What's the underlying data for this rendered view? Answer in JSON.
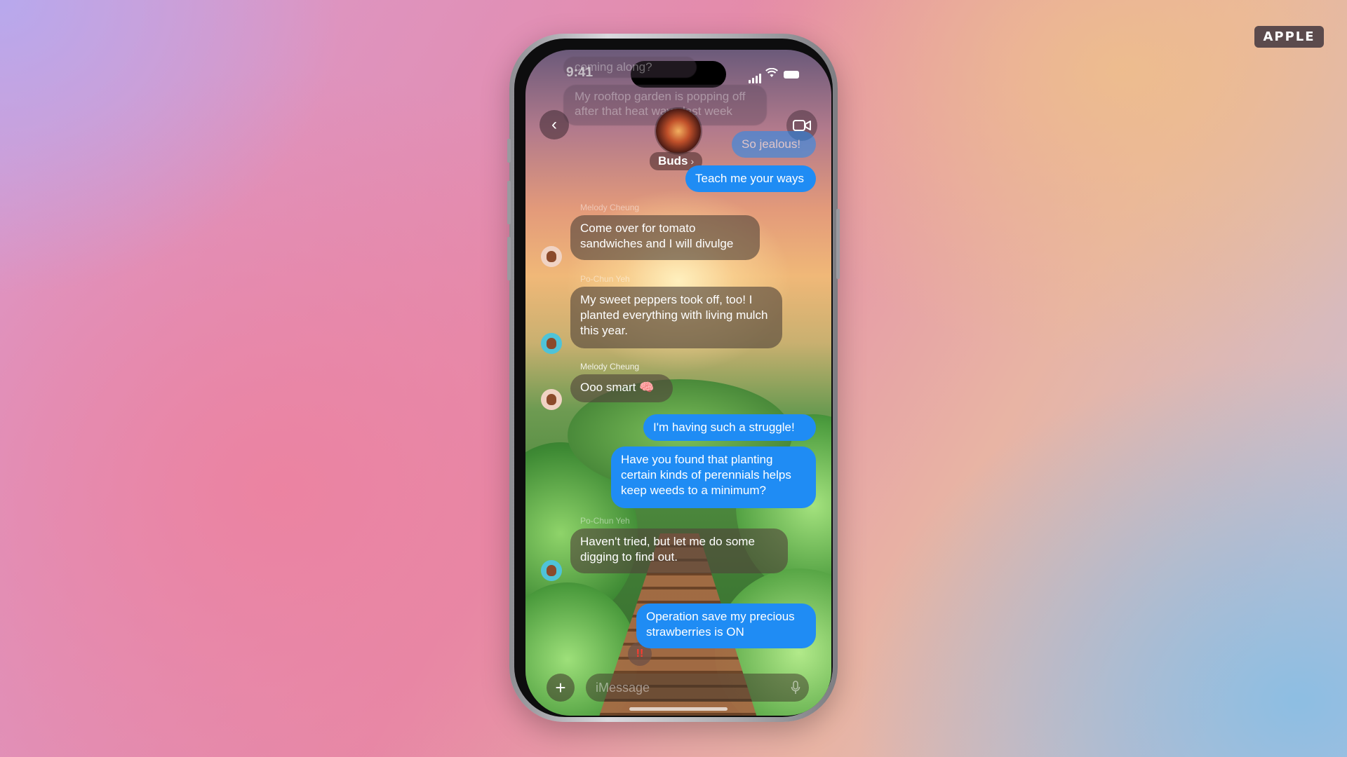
{
  "watermark": "APPLE",
  "status_bar": {
    "time": "9:41"
  },
  "conversation": {
    "group_name": "Buds",
    "group_chevron": "›",
    "back_glyph": "‹",
    "video_icon": "video-camera-icon"
  },
  "ghost_messages": {
    "line1": "coming along?",
    "line2": "My rooftop garden is popping off",
    "line3": "after that heat wave last week"
  },
  "messages": [
    {
      "id": "m1",
      "direction": "outgoing",
      "text": "So jealous!"
    },
    {
      "id": "m2",
      "direction": "outgoing",
      "text": "Teach me your ways"
    },
    {
      "id": "m3",
      "direction": "incoming",
      "sender": "Melody Cheung",
      "text": "Come over for tomato sandwiches and I will divulge"
    },
    {
      "id": "m4",
      "direction": "incoming",
      "sender": "Po-Chun Yeh",
      "text": "My sweet peppers took off, too! I planted everything with living mulch this year."
    },
    {
      "id": "m5",
      "direction": "incoming",
      "sender": "Melody Cheung",
      "text": "Ooo smart",
      "emoji": "🧠"
    },
    {
      "id": "m6",
      "direction": "outgoing",
      "text": "I'm having such a struggle!"
    },
    {
      "id": "m7",
      "direction": "outgoing",
      "text": "Have you found that planting certain kinds of perennials helps keep weeds to a minimum?"
    },
    {
      "id": "m8",
      "direction": "incoming",
      "sender": "Po-Chun Yeh",
      "text": "Haven't tried, but let me do some digging to find out."
    },
    {
      "id": "m9",
      "direction": "outgoing",
      "text": "Operation save my precious strawberries is ON",
      "reaction": "!!"
    }
  ],
  "composer": {
    "placeholder": "iMessage",
    "plus_glyph": "+"
  },
  "colors": {
    "outgoing_bubble": "#1f8cf4",
    "brand_badge": "#5b4a4c"
  }
}
